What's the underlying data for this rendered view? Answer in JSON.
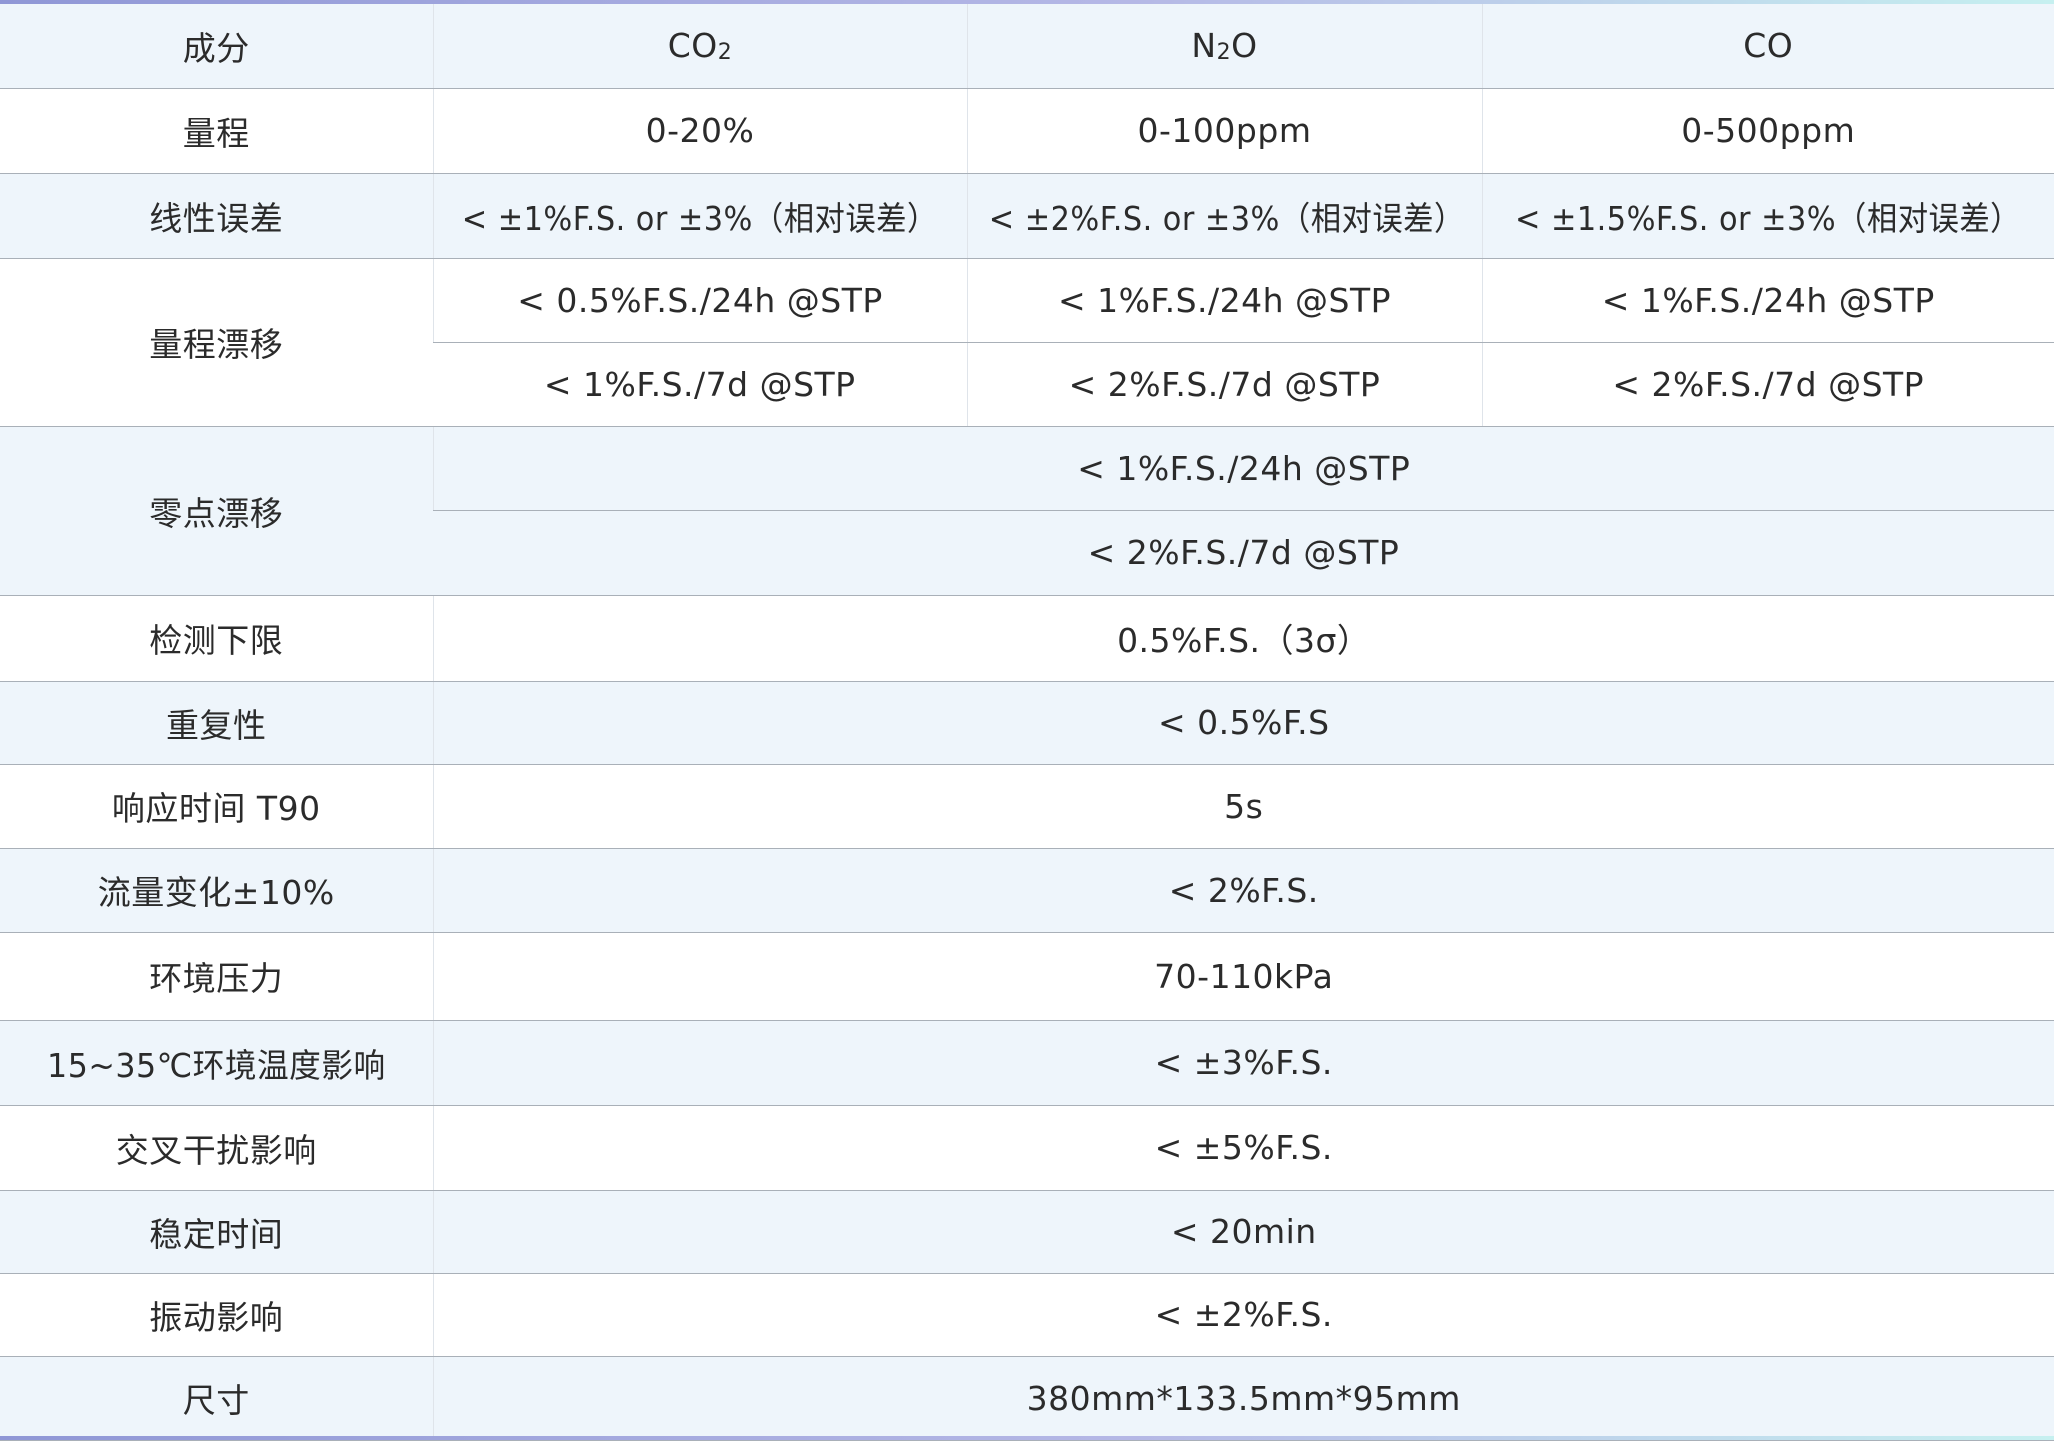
{
  "header": {
    "label": "成分",
    "components": [
      {
        "main": "CO",
        "sub": "2",
        "tail": ""
      },
      {
        "main": "N",
        "sub": "2",
        "tail": "O"
      },
      {
        "main": "CO",
        "sub": "",
        "tail": ""
      }
    ]
  },
  "range": {
    "label": "量程",
    "values": [
      "0-20%",
      "0-100ppm",
      "0-500ppm"
    ]
  },
  "linearity": {
    "label": "线性误差",
    "values": [
      "< ±1%F.S. or ±3%（相对误差）",
      "< ±2%F.S. or ±3%（相对误差）",
      "< ±1.5%F.S. or ±3%（相对误差）"
    ]
  },
  "span_drift": {
    "label": "量程漂移",
    "row_24h": [
      "< 0.5%F.S./24h @STP",
      "< 1%F.S./24h @STP",
      "< 1%F.S./24h @STP"
    ],
    "row_7d": [
      "< 1%F.S./7d @STP",
      "< 2%F.S./7d @STP",
      "< 2%F.S./7d @STP"
    ]
  },
  "zero_drift": {
    "label": "零点漂移",
    "row_24h": "< 1%F.S./24h @STP",
    "row_7d": "< 2%F.S./7d @STP"
  },
  "detection_limit": {
    "label": "检测下限",
    "value": "0.5%F.S.（3σ）"
  },
  "repeatability": {
    "label": "重复性",
    "value": "<  0.5%F.S"
  },
  "response_time": {
    "label": "响应时间 T90",
    "value": "5s"
  },
  "flow_change": {
    "label": "流量变化±10%",
    "value": "< 2%F.S."
  },
  "ambient_pressure": {
    "label": "环境压力",
    "value": "70-110kPa"
  },
  "temperature_effect": {
    "label": "15~35℃环境温度影响",
    "value": "< ±3%F.S."
  },
  "cross_interference": {
    "label": "交叉干扰影响",
    "value": "< ±5%F.S."
  },
  "stabilization_time": {
    "label": "稳定时间",
    "value": "<  20min"
  },
  "vibration_effect": {
    "label": "振动影响",
    "value": "< ±2%F.S."
  },
  "dimensions": {
    "label": "尺寸",
    "value": "380mm*133.5mm*95mm"
  },
  "colors": {
    "row_alt": "#eef5fb",
    "row_plain": "#ffffff",
    "border": "#a9b0b8",
    "accent_start": "#8f97d6",
    "accent_end": "#c6f0f0",
    "text": "#2b2b2b"
  }
}
